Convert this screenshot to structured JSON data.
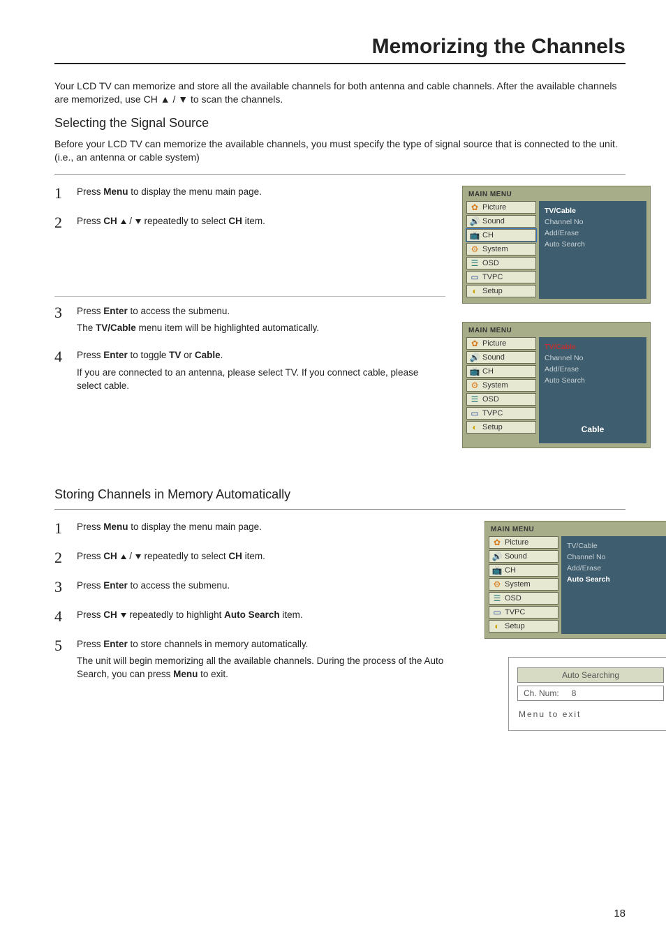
{
  "title": "Memorizing the Channels",
  "intro": "Your LCD TV can memorize and store all the available channels for both antenna and cable channels. After the  available channels are memorized, use CH ▲ / ▼ to scan the channels.",
  "sectionA": {
    "heading": "Selecting the Signal Source",
    "lead": "Before your LCD TV can memorize the available channels, you must specify the type of signal  source that is connected to the unit. (i.e., an antenna or cable system)",
    "steps": {
      "s1": {
        "num": "1",
        "pre": "Press  ",
        "b": "Menu",
        "post": " to display the menu main page."
      },
      "s2": {
        "num": "2",
        "pre": "Press ",
        "b1": "CH ",
        "mid": " repeatedly to select ",
        "b2": "CH",
        "post": " item."
      },
      "s3": {
        "num": "3",
        "pre": "Press ",
        "b": "Enter",
        "post": " to access the submenu.",
        "note_pre": "The ",
        "note_b": "TV/Cable",
        "note_post": " menu item will be highlighted automatically."
      },
      "s4": {
        "num": "4",
        "pre": "Press ",
        "b1": "Enter",
        "mid": " to toggle ",
        "b2": "TV",
        "or": " or ",
        "b3": "Cable",
        "post": ".",
        "note": "If you are connected to an antenna, please select TV. If you connect cable, please select cable."
      }
    }
  },
  "osd": {
    "header": "MAIN MENU",
    "items": {
      "picture": "Picture",
      "sound": "Sound",
      "ch": "CH",
      "system": "System",
      "osd": "OSD",
      "tvpc": "TVPC",
      "setup": "Setup"
    },
    "right": {
      "l1": "TV/Cable",
      "l2": "Channel No",
      "l3": "Add/Erase",
      "l4": "Auto Search"
    },
    "panel2_value": "Cable"
  },
  "sectionB": {
    "heading": "Storing Channels in Memory Automatically",
    "steps": {
      "s1": {
        "num": "1",
        "pre": "Press  ",
        "b": "Menu",
        "post": " to display the menu main page."
      },
      "s2": {
        "num": "2",
        "pre": "Press ",
        "b1": "CH ",
        "mid": " repeatedly to select ",
        "b2": "CH",
        "post": " item."
      },
      "s3": {
        "num": "3",
        "pre": "Press ",
        "b": "Enter",
        "post": " to access the submenu."
      },
      "s4": {
        "num": "4",
        "pre": "Press ",
        "b1": "CH ",
        "mid": " repeatedly to highlight ",
        "b2": "Auto Search",
        "post": " item."
      },
      "s5": {
        "num": "5",
        "pre": "Press ",
        "b": "Enter",
        "post": " to store channels in memory automatically.",
        "note_pre": "The unit will begin memorizing all the available channels. During the process of the Auto Search, you can press ",
        "note_b": "Menu",
        "note_post": " to exit."
      }
    }
  },
  "autoSearching": {
    "head": "Auto Searching",
    "label": "Ch. Num:",
    "value": "8",
    "foot": "Menu to exit"
  },
  "pageNumber": "18"
}
